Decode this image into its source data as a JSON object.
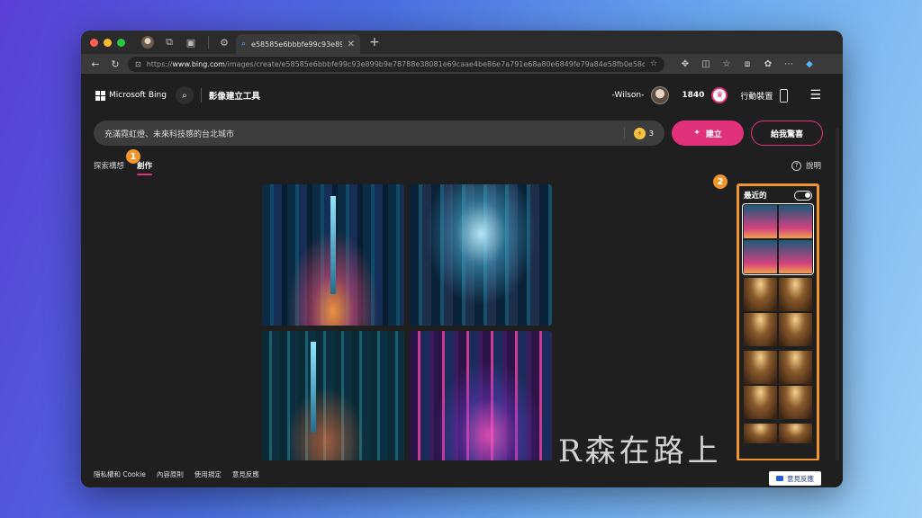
{
  "browser": {
    "tab_title": "e58585e6bbbfe99c93e899b6",
    "url_host": "www.bing.com",
    "url_prefix": "https://",
    "url_path": "/images/create/e58585e6bbbfe99c93e899b9e78788e38081e69caae4be86e7a791e68a80e6849fe79a84e58fb0e58c9..."
  },
  "header": {
    "brand": "Microsoft Bing",
    "product": "影像建立工具",
    "username": "-Wilson-",
    "points": "1840",
    "mobile": "行動裝置"
  },
  "prompt": {
    "text": "充滿霓虹燈、未來科技感的台北城市",
    "boosts": "3",
    "create_label": "建立",
    "surprise_label": "給我驚喜"
  },
  "subnav": {
    "explore": "探索構想",
    "create": "創作",
    "help": "說明"
  },
  "badges": {
    "one": "1",
    "two": "2"
  },
  "recent": {
    "title": "最近的"
  },
  "footer": {
    "links": [
      "隱私權和 Cookie",
      "內容原則",
      "使用規定",
      "意見反應"
    ],
    "feedback_button": "意見反應"
  },
  "watermark": "R森在路上",
  "colors": {
    "accent": "#e0317a",
    "highlight": "#f0962c"
  }
}
